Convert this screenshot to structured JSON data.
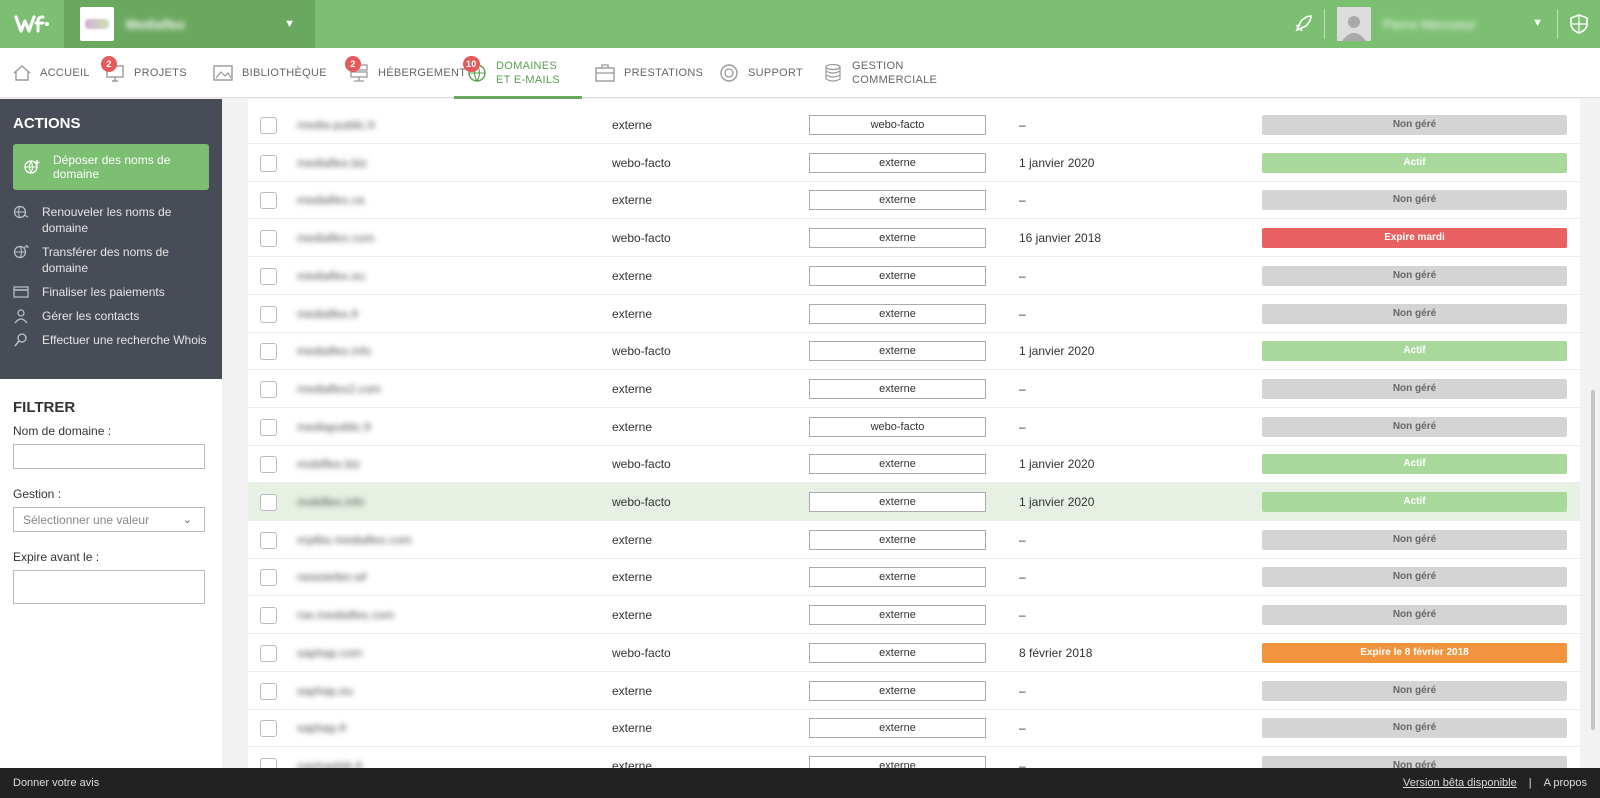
{
  "header": {
    "company_name": "Mediaflex",
    "user_name": "Pierre Mercoeur"
  },
  "nav": [
    {
      "label": "Accueil",
      "icon": "home-icon",
      "badge": ""
    },
    {
      "label": "Projets",
      "icon": "monitor-icon",
      "badge": "2"
    },
    {
      "label": "Bibliothèque",
      "icon": "image-icon",
      "badge": ""
    },
    {
      "label": "Hébergement",
      "icon": "server-icon",
      "badge": "2"
    },
    {
      "label": "Domaines\net e-mails",
      "icon": "globe-icon",
      "badge": "10",
      "active": true
    },
    {
      "label": "Prestations",
      "icon": "briefcase-icon",
      "badge": ""
    },
    {
      "label": "Support",
      "icon": "lifebuoy-icon",
      "badge": ""
    },
    {
      "label": "Gestion\ncommerciale",
      "icon": "coins-icon",
      "badge": ""
    }
  ],
  "actions": {
    "title": "ACTIONS",
    "primary": "Déposer des noms de domaine",
    "items": [
      {
        "label": "Renouveler les noms de domaine",
        "icon": "globe-refresh-icon"
      },
      {
        "label": "Transférer des noms de domaine",
        "icon": "globe-transfer-icon"
      },
      {
        "label": "Finaliser les paiements",
        "icon": "credit-card-icon"
      },
      {
        "label": "Gérer les contacts",
        "icon": "user-icon"
      },
      {
        "label": "Effectuer une recherche Whois",
        "icon": "search-icon"
      }
    ]
  },
  "filter": {
    "title": "FILTRER",
    "domain_label": "Nom de domaine :",
    "domain_value": "",
    "gestion_label": "Gestion :",
    "gestion_placeholder": "Sélectionner une valeur",
    "expire_label": "Expire avant le :",
    "expire_value": ""
  },
  "colors": {
    "brand_green": "#7cbf72",
    "status_active": "#a8d99b",
    "status_expire_red": "#e86060",
    "status_expire_orange": "#f2943d",
    "status_unmanaged": "#d4d4d4"
  },
  "domains": [
    {
      "name": "media-public.fr",
      "registrar": "externe",
      "management": "webo-facto",
      "expiry": "–",
      "status": "Non géré",
      "status_type": "gray"
    },
    {
      "name": "mediaflex.biz",
      "registrar": "webo-facto",
      "management": "externe",
      "expiry": "1 janvier 2020",
      "status": "Actif",
      "status_type": "green"
    },
    {
      "name": "mediaflex.ca",
      "registrar": "externe",
      "management": "externe",
      "expiry": "–",
      "status": "Non géré",
      "status_type": "gray"
    },
    {
      "name": "mediaflex.com",
      "registrar": "webo-facto",
      "management": "externe",
      "expiry": "16 janvier 2018",
      "status": "Expire mardi",
      "status_type": "red"
    },
    {
      "name": "mediaflex.eu",
      "registrar": "externe",
      "management": "externe",
      "expiry": "–",
      "status": "Non géré",
      "status_type": "gray"
    },
    {
      "name": "mediaflex.fr",
      "registrar": "externe",
      "management": "externe",
      "expiry": "–",
      "status": "Non géré",
      "status_type": "gray"
    },
    {
      "name": "mediaflex.info",
      "registrar": "webo-facto",
      "management": "externe",
      "expiry": "1 janvier 2020",
      "status": "Actif",
      "status_type": "green"
    },
    {
      "name": "mediaflex2.com",
      "registrar": "externe",
      "management": "externe",
      "expiry": "–",
      "status": "Non géré",
      "status_type": "gray"
    },
    {
      "name": "mediapublic.fr",
      "registrar": "externe",
      "management": "webo-facto",
      "expiry": "–",
      "status": "Non géré",
      "status_type": "gray"
    },
    {
      "name": "mobiflex.biz",
      "registrar": "webo-facto",
      "management": "externe",
      "expiry": "1 janvier 2020",
      "status": "Actif",
      "status_type": "green"
    },
    {
      "name": "mobiflex.info",
      "registrar": "webo-facto",
      "management": "externe",
      "expiry": "1 janvier 2020",
      "status": "Actif",
      "status_type": "green",
      "highlight": true
    },
    {
      "name": "mylibs.mediaflex.com",
      "registrar": "externe",
      "management": "externe",
      "expiry": "–",
      "status": "Non géré",
      "status_type": "gray"
    },
    {
      "name": "newsletter.wf",
      "registrar": "externe",
      "management": "externe",
      "expiry": "–",
      "status": "Non géré",
      "status_type": "gray"
    },
    {
      "name": "rse.mediaflex.com",
      "registrar": "externe",
      "management": "externe",
      "expiry": "–",
      "status": "Non géré",
      "status_type": "gray"
    },
    {
      "name": "saphap.com",
      "registrar": "webo-facto",
      "management": "externe",
      "expiry": "8 février 2018",
      "status": "Expire le 8 février 2018",
      "status_type": "orange"
    },
    {
      "name": "saphap.eu",
      "registrar": "externe",
      "management": "externe",
      "expiry": "–",
      "status": "Non géré",
      "status_type": "gray"
    },
    {
      "name": "saphap.fr",
      "registrar": "externe",
      "management": "externe",
      "expiry": "–",
      "status": "Non géré",
      "status_type": "gray"
    },
    {
      "name": "saphapbib.fr",
      "registrar": "externe",
      "management": "externe",
      "expiry": "–",
      "status": "Non géré",
      "status_type": "gray"
    }
  ],
  "footer": {
    "feedback": "Donner votre avis",
    "beta": "Version bêta disponible",
    "separator": "|",
    "about": "A propos"
  }
}
